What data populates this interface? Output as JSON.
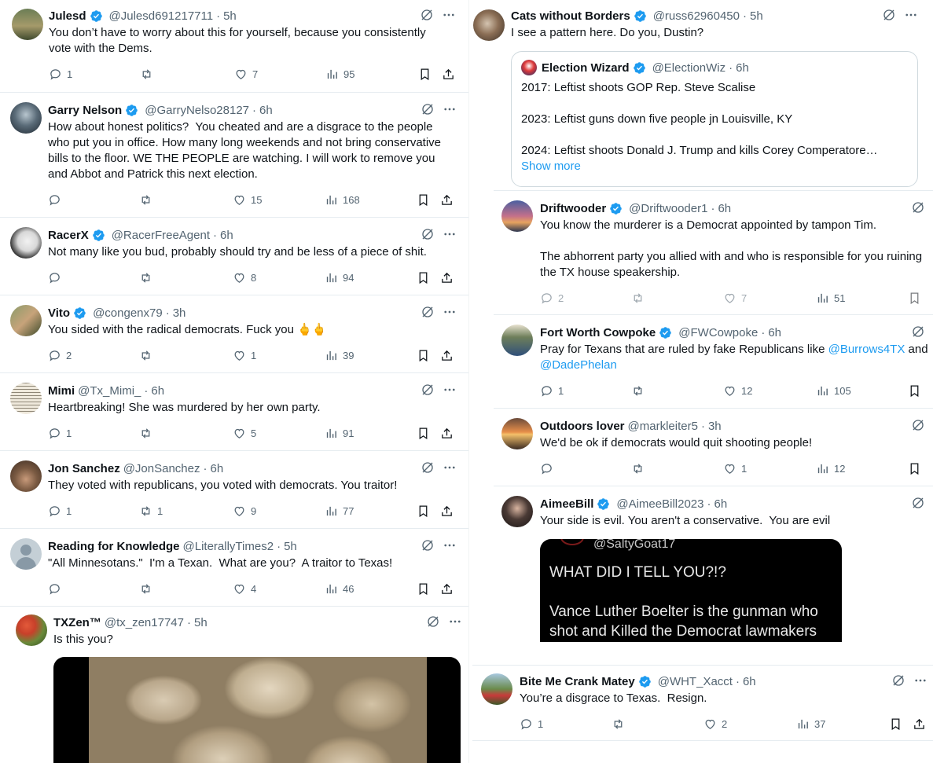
{
  "left_column": [
    {
      "name": "Julesd",
      "handle": "@Julesd691217711",
      "time": "5h",
      "verified": true,
      "text": "You don’t have to worry about this for yourself, because you consistently\nvote with the Dems.",
      "replies": "1",
      "reposts": "",
      "likes": "7",
      "views": "95"
    },
    {
      "name": "Garry Nelson",
      "handle": "@GarryNelso28127",
      "time": "6h",
      "verified": true,
      "text": "How about honest politics?  You cheated and are a disgrace to the people\nwho put you in office. How many long weekends and not bring conservative\nbills to the floor. WE THE PEOPLE are watching. I will work to remove you\nand Abbot and Patrick this next election.",
      "replies": "",
      "reposts": "",
      "likes": "15",
      "views": "168"
    },
    {
      "name": "RacerX",
      "handle": "@RacerFreeAgent",
      "time": "6h",
      "verified": true,
      "text": "Not many like you bud, probably should try and be less of a piece of shit.",
      "replies": "",
      "reposts": "",
      "likes": "8",
      "views": "94"
    },
    {
      "name": "Vito",
      "handle": "@congenx79",
      "time": "3h",
      "verified": true,
      "text": "You sided with the radical democrats. Fuck you 🖕🖕",
      "replies": "2",
      "reposts": "",
      "likes": "1",
      "views": "39"
    },
    {
      "name": "Mimi",
      "handle": "@Tx_Mimi_",
      "time": "6h",
      "verified": false,
      "text": "Heartbreaking! She was murdered by her own party.",
      "replies": "1",
      "reposts": "",
      "likes": "5",
      "views": "91"
    },
    {
      "name": "Jon Sanchez",
      "handle": "@JonSanchez",
      "time": "6h",
      "verified": false,
      "text": "They voted with republicans, you voted with democrats. You traitor!",
      "replies": "1",
      "reposts": "1",
      "likes": "9",
      "views": "77"
    },
    {
      "name": "Reading for Knowledge",
      "handle": "@LiterallyTimes2",
      "time": "5h",
      "verified": false,
      "text": "\"All Minnesotans.\"  I'm a Texan.  What are you?  A traitor to Texas!",
      "replies": "",
      "reposts": "",
      "likes": "4",
      "views": "46"
    },
    {
      "name": "TXZen™",
      "handle": "@tx_zen17747",
      "time": "5h",
      "verified": false,
      "text": "Is this you?"
    }
  ],
  "right_column": {
    "cats": {
      "name": "Cats without Borders",
      "handle": "@russ62960450",
      "time": "5h",
      "verified": true,
      "text": "I see a pattern here. Do you, Dustin?",
      "quote": {
        "name": "Election Wizard",
        "handle": "@ElectionWiz",
        "time": "6h",
        "verified": true,
        "lines": [
          "2017: Leftist shoots GOP Rep. Steve Scalise",
          "2023: Leftist guns down five people jn Louisville, KY",
          "2024: Leftist shoots Donald J. Trump and kills Corey Comperatore…"
        ],
        "show_more": "Show more"
      }
    },
    "driftwooder": {
      "name": "Driftwooder",
      "handle": "@Driftwooder1",
      "time": "6h",
      "verified": true,
      "text": "You know the murderer is a Democrat appointed by tampon Tim.\n\nThe abhorrent party you allied with and who is responsible for you ruining\nthe TX house speakership.",
      "replies": "2",
      "reposts": "",
      "likes": "7",
      "views": "51"
    },
    "fortworth": {
      "name": "Fort Worth Cowpoke",
      "handle": "@FWCowpoke",
      "time": "6h",
      "verified": true,
      "text_before": "Pray for Texans that are ruled by fake Republicans like ",
      "mention1": "@Burrows4TX",
      "text_mid": " and",
      "mention2": "@DadePhelan",
      "replies": "1",
      "reposts": "",
      "likes": "12",
      "views": "105"
    },
    "outdoors": {
      "name": "Outdoors lover",
      "handle": "@markleiter5",
      "time": "3h",
      "verified": false,
      "text": "We'd be ok if democrats would quit shooting people!",
      "replies": "",
      "reposts": "",
      "likes": "1",
      "views": "12"
    },
    "aimee": {
      "name": "AimeeBill",
      "handle": "@AimeeBill2023",
      "time": "6h",
      "verified": true,
      "text": "Your side is evil. You aren't a conservative.  You are evil",
      "media": {
        "handle": "@SaltyGoat17",
        "line1": "WHAT DID I TELL YOU?!?",
        "line2": "Vance Luther Boelter is the gunman who",
        "line3": "shot and Killed the Democrat lawmakers"
      }
    },
    "biteme": {
      "name": "Bite Me Crank Matey",
      "handle": "@WHT_Xacct",
      "time": "6h",
      "verified": true,
      "text": "You’re a disgrace to Texas.  Resign.",
      "replies": "1",
      "reposts": "",
      "likes": "2",
      "views": "37"
    }
  },
  "separator": "·",
  "colors": {
    "verified": "#1d9bf0",
    "text": "#0f1419",
    "muted": "#536471",
    "link": "#1d9bf0",
    "border": "#e6ecf0"
  },
  "icons": [
    "verified-badge-icon",
    "grok-icon",
    "more-icon",
    "reply-icon",
    "repost-icon",
    "like-icon",
    "views-icon",
    "bookmark-icon",
    "share-icon"
  ]
}
